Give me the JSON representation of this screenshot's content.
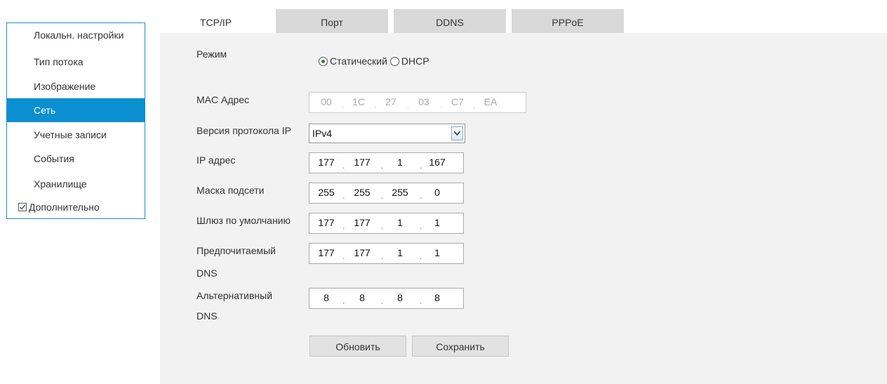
{
  "sidebar": {
    "items": [
      {
        "label": "Локальн. настройки"
      },
      {
        "label": "Тип потока"
      },
      {
        "label": "Изображение"
      },
      {
        "label": "Сеть"
      },
      {
        "label": "Учетные записи"
      },
      {
        "label": "События"
      },
      {
        "label": "Хранилище"
      }
    ],
    "advanced_label": "Дополнительно",
    "advanced_checked": true,
    "active_color": "#0a8fd0"
  },
  "tabs": [
    {
      "label": "TCP/IP",
      "active": true
    },
    {
      "label": "Порт",
      "active": false
    },
    {
      "label": "DDNS",
      "active": false
    },
    {
      "label": "PPPoE",
      "active": false
    }
  ],
  "form": {
    "mode": {
      "label": "Режим",
      "options": [
        "Статический",
        "DHCP"
      ],
      "selected": "Статический"
    },
    "mac": {
      "label": "MAC Адрес",
      "octets": [
        "00",
        "1C",
        "27",
        "03",
        "C7",
        "EA"
      ]
    },
    "ip_version": {
      "label": "Версия протокола IP",
      "value": "IPv4"
    },
    "ip_address": {
      "label": "IP адрес",
      "octets": [
        "177",
        "177",
        "1",
        "167"
      ]
    },
    "subnet_mask": {
      "label": "Маска подсети",
      "octets": [
        "255",
        "255",
        "255",
        "0"
      ]
    },
    "gateway": {
      "label": "Шлюз по умолчанию",
      "octets": [
        "177",
        "177",
        "1",
        "1"
      ]
    },
    "preferred_dns": {
      "label_line1": "Предпочитаемый",
      "label_line2": "DNS",
      "octets": [
        "177",
        "177",
        "1",
        "1"
      ]
    },
    "alternate_dns": {
      "label_line1": "Альтернативный",
      "label_line2": "DNS",
      "octets": [
        "8",
        "8",
        "8",
        "8"
      ]
    }
  },
  "buttons": {
    "refresh": "Обновить",
    "save": "Сохранить"
  }
}
